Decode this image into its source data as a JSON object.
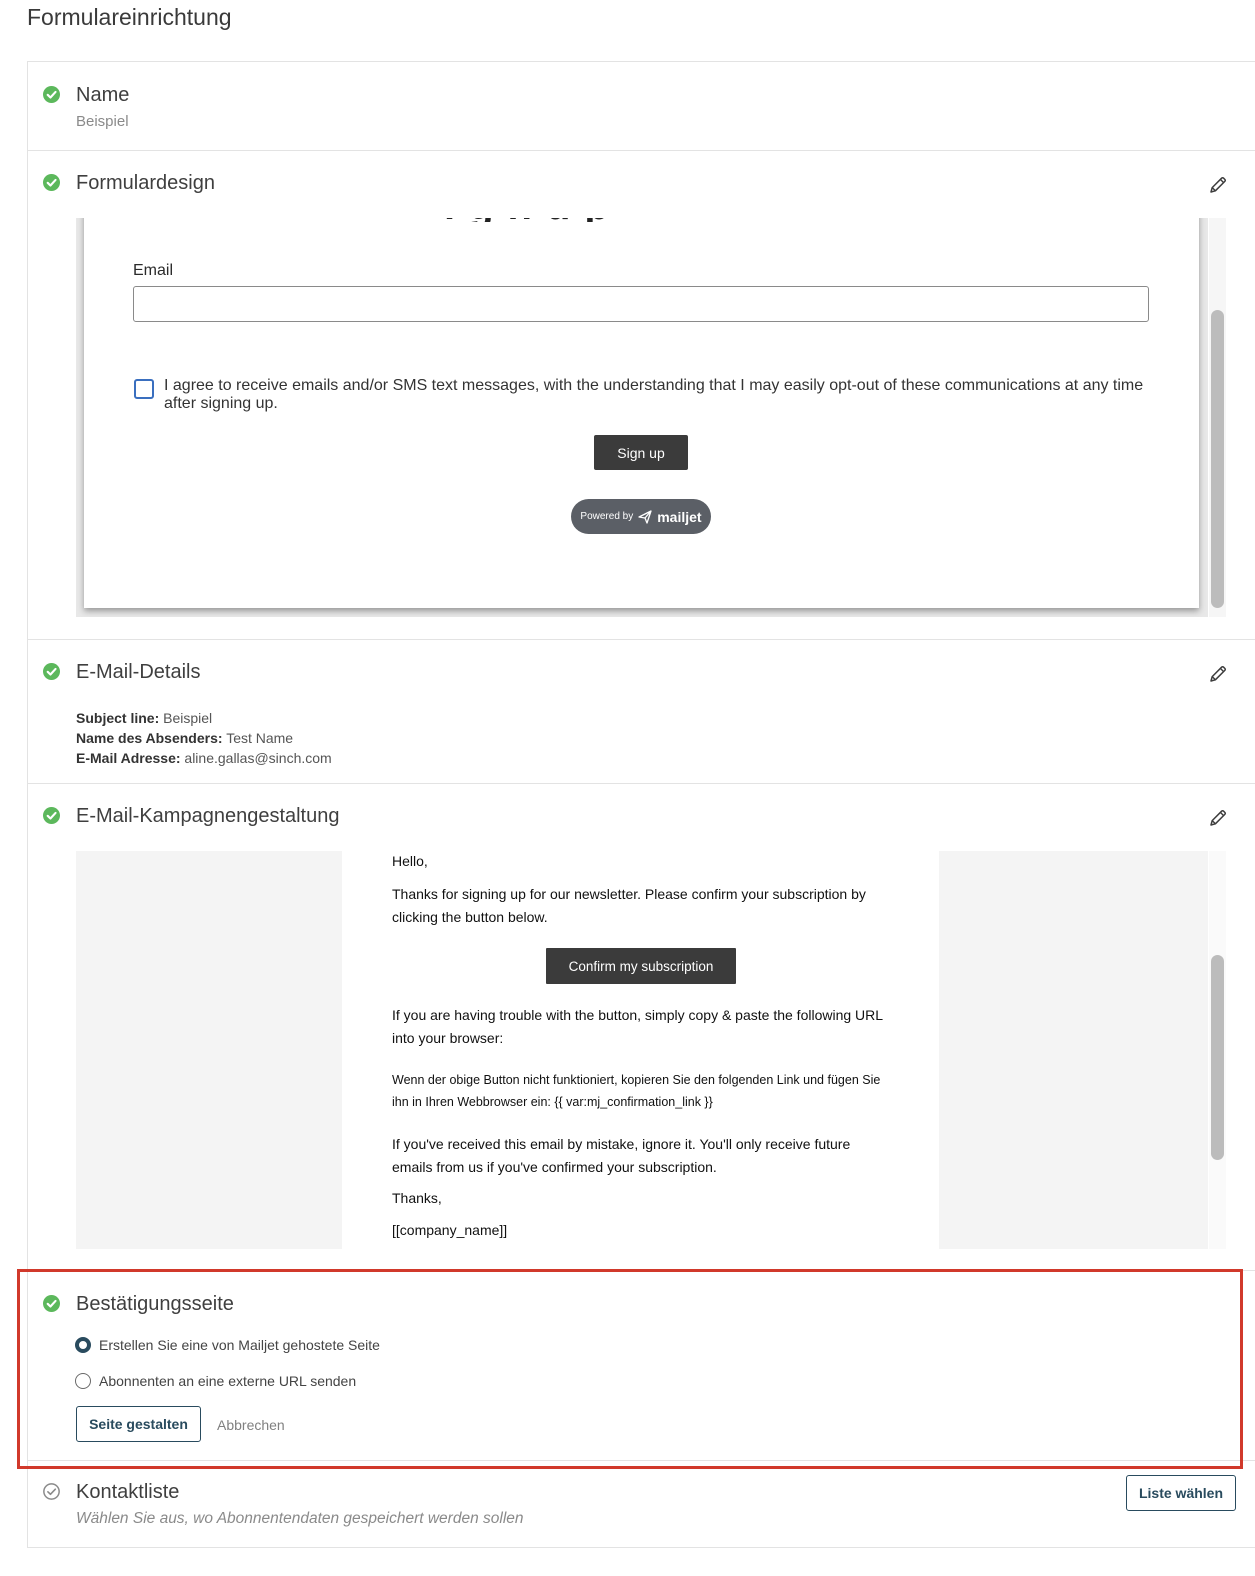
{
  "page": {
    "title": "Formulareinrichtung"
  },
  "steps": {
    "name": {
      "title": "Name",
      "value": "Beispiel"
    },
    "form_design": {
      "title": "Formulardesign",
      "preview": {
        "email_label": "Email",
        "consent_text": "I agree to receive emails and/or SMS text messages, with the understanding that I may easily opt-out of these communications at any time after signing up.",
        "signup_label": "Sign up",
        "powered_by": "Powered by",
        "brand": "mailjet"
      }
    },
    "email_details": {
      "title": "E-Mail-Details",
      "subject_label": "Subject line:",
      "subject_value": "Beispiel",
      "sender_label": "Name des Absenders:",
      "sender_value": "Test Name",
      "address_label": "E-Mail Adresse:",
      "address_value": "aline.gallas@sinch.com"
    },
    "campaign_design": {
      "title": "E-Mail-Kampagnengestaltung",
      "preview": {
        "greeting": "Hello,",
        "intro": "Thanks for signing up for our newsletter. Please confirm your subscription by clicking the button below.",
        "confirm_label": "Confirm my subscription",
        "trouble": "If you are having trouble with the button, simply copy & paste the following URL into your browser:",
        "german_hint": "Wenn der obige Button nicht funktioniert, kopieren Sie den folgenden Link und fügen Sie ihn in Ihren Webbrowser ein: {{ var:mj_confirmation_link }}",
        "mistake": "If you've received this email by mistake, ignore it. You'll only receive future emails from us if you've confirmed your subscription.",
        "thanks": "Thanks,",
        "company": "[[company_name]]"
      }
    },
    "confirmation_page": {
      "title": "Bestätigungsseite",
      "option_hosted": "Erstellen Sie eine von Mailjet gehostete Seite",
      "option_external": "Abonnenten an eine externe URL senden",
      "design_button": "Seite gestalten",
      "cancel_link": "Abbrechen"
    },
    "contact_list": {
      "title": "Kontaktliste",
      "subtitle": "Wählen Sie aus, wo Abonnentendaten gespeichert werden sollen",
      "choose_button": "Liste wählen"
    }
  },
  "colors": {
    "complete": "#5cb85c",
    "pending": "#8a8a8a",
    "primary": "#294b5e",
    "highlight": "#d1392b"
  },
  "icons": {
    "complete": "check-circle-icon",
    "pending": "check-circle-outline-icon",
    "edit": "pencil-icon",
    "brand": "paper-plane-icon"
  }
}
